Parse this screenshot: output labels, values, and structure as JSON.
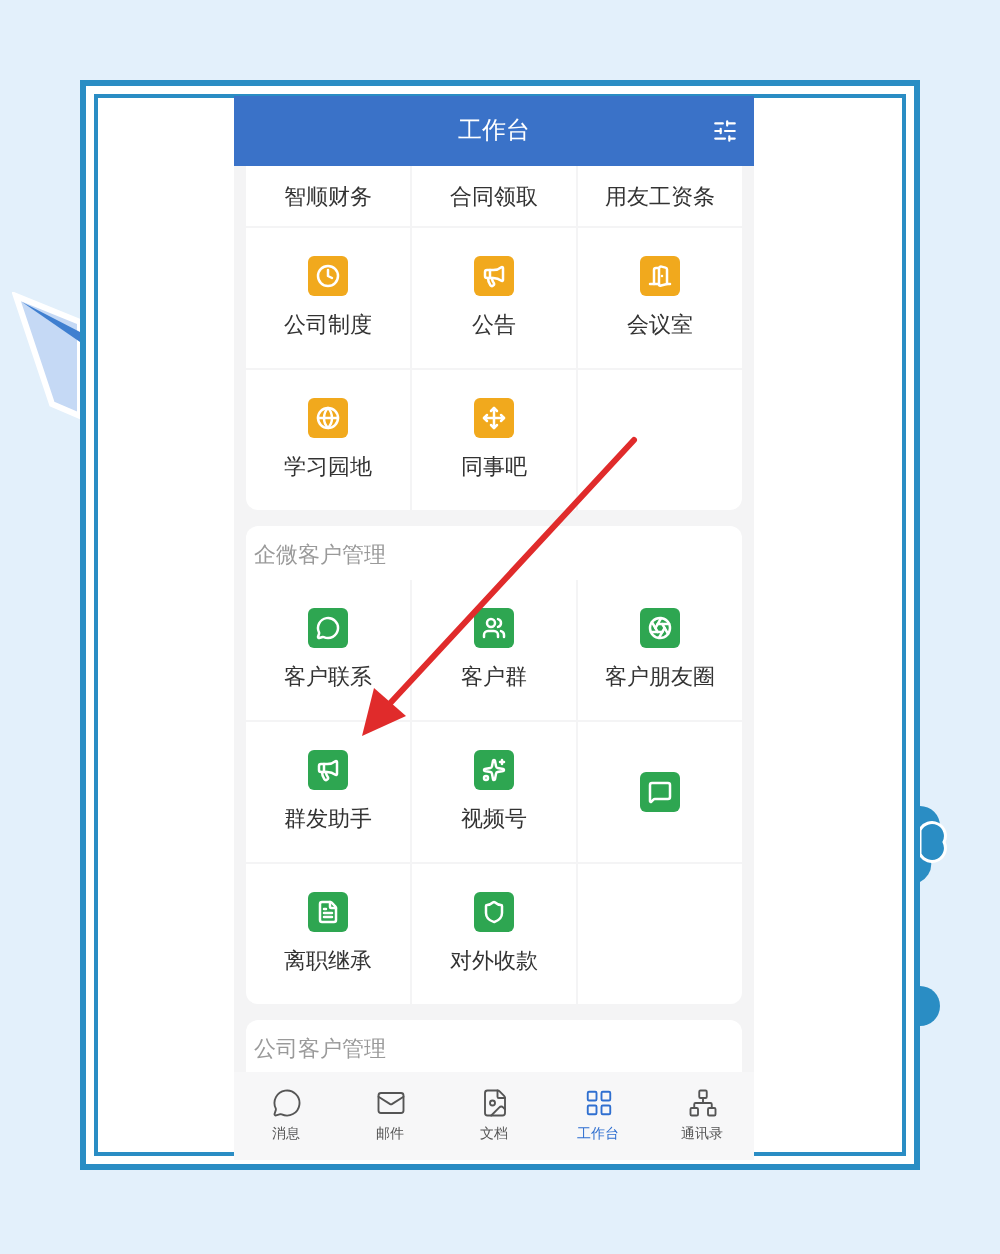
{
  "header": {
    "title": "工作台"
  },
  "sections": [
    {
      "items": [
        {
          "label": "智顺财务",
          "kind": "cut"
        },
        {
          "label": "合同领取",
          "kind": "cut"
        },
        {
          "label": "用友工资条",
          "kind": "cut"
        },
        {
          "label": "公司制度",
          "kind": "icon"
        },
        {
          "label": "公告",
          "kind": "icon"
        },
        {
          "label": "会议室",
          "kind": "icon"
        },
        {
          "label": "学习园地",
          "kind": "icon"
        },
        {
          "label": "同事吧",
          "kind": "icon"
        }
      ]
    },
    {
      "title": "企微客户管理",
      "items": [
        {
          "label": "客户联系",
          "kind": "icon"
        },
        {
          "label": "客户群",
          "kind": "icon"
        },
        {
          "label": "客户朋友圈",
          "kind": "icon"
        },
        {
          "label": "群发助手",
          "kind": "icon"
        },
        {
          "label": "视频号",
          "kind": "icon"
        },
        {
          "kind": "icon"
        },
        {
          "label": "离职继承",
          "kind": "icon"
        },
        {
          "label": "对外收款",
          "kind": "icon"
        }
      ]
    },
    {
      "title": "公司客户管理"
    }
  ],
  "tabs": [
    {
      "label": "消息",
      "selected": false
    },
    {
      "label": "邮件",
      "selected": false
    },
    {
      "label": "文档",
      "selected": false
    },
    {
      "label": "工作台",
      "selected": true
    },
    {
      "label": "通讯录",
      "selected": false
    }
  ]
}
